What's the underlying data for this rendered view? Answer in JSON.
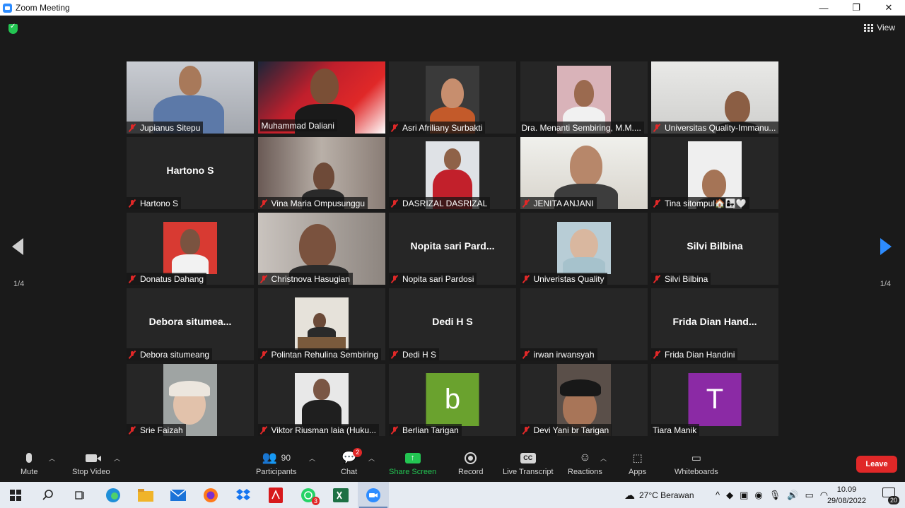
{
  "window": {
    "title": "Zoom Meeting"
  },
  "meeting": {
    "view_label": "View",
    "page_indicator_left": "1/4",
    "page_indicator_right": "1/4"
  },
  "participants": [
    {
      "name": "Jupianus Sitepu",
      "video": true
    },
    {
      "name": "Muhammad Daliani",
      "video": true,
      "active": true
    },
    {
      "name": "Asri Afriliany Surbakti",
      "video": true
    },
    {
      "name": "Dra. Menanti Sembiring, M.M....",
      "video": true
    },
    {
      "name": "Universitas Quality-Immanu...",
      "video": true
    },
    {
      "name": "Hartono S",
      "display_name": "Hartono S",
      "video": false
    },
    {
      "name": "Vina Maria Ompusunggu",
      "video": true
    },
    {
      "name": "DASRIZAL DASRIZAL",
      "video": true
    },
    {
      "name": "JENITA ANJANI",
      "video": true
    },
    {
      "name": "Tina sitompul🏠👩‍👧🤍",
      "video": true
    },
    {
      "name": "Donatus Dahang",
      "video": true
    },
    {
      "name": "Christnova Hasugian",
      "video": true
    },
    {
      "name": "Nopita sari Pardosi",
      "display_name": "Nopita  sari  Pard...",
      "video": false
    },
    {
      "name": "Univeristas Quality",
      "video": true
    },
    {
      "name": "Silvi Bilbina",
      "display_name": "Silvi Bilbina",
      "video": false
    },
    {
      "name": "Debora situmeang",
      "display_name": "Debora  situmea...",
      "video": false
    },
    {
      "name": "Polintan Rehulina Sembiring",
      "video": true
    },
    {
      "name": "Dedi H S",
      "display_name": "Dedi H S",
      "video": false
    },
    {
      "name": "irwan irwansyah",
      "video": false
    },
    {
      "name": "Frida Dian Handini",
      "display_name": "Frida  Dian  Hand...",
      "video": false
    },
    {
      "name": "Srie Faizah",
      "video": true
    },
    {
      "name": "Viktor Riusman laia (Huku...",
      "video": true
    },
    {
      "name": "Berlian Tarigan",
      "avatar_letter": "b",
      "avatar_color": "#6aa22e"
    },
    {
      "name": "Devi Yani br Tarigan",
      "video": true
    },
    {
      "name": "Tiara Manik",
      "avatar_letter": "T",
      "avatar_color": "#8b2aa5"
    }
  ],
  "toolbar": {
    "mute": "Mute",
    "stop_video": "Stop Video",
    "participants_count": "90",
    "participants": "Participants",
    "chat": "Chat",
    "chat_badge": "2",
    "share_screen": "Share Screen",
    "record": "Record",
    "live_transcript": "Live Transcript",
    "cc_label": "CC",
    "reactions": "Reactions",
    "apps": "Apps",
    "whiteboards": "Whiteboards",
    "leave": "Leave"
  },
  "taskbar": {
    "whatsapp_badge": "3",
    "weather": "27°C  Berawan",
    "time": "10.09",
    "date": "29/08/2022",
    "notifications": "20"
  },
  "colors": {
    "accent": "#2d8cff",
    "share_green": "#23c552",
    "leave_red": "#e02828",
    "active_speaker": "#d8f063"
  }
}
